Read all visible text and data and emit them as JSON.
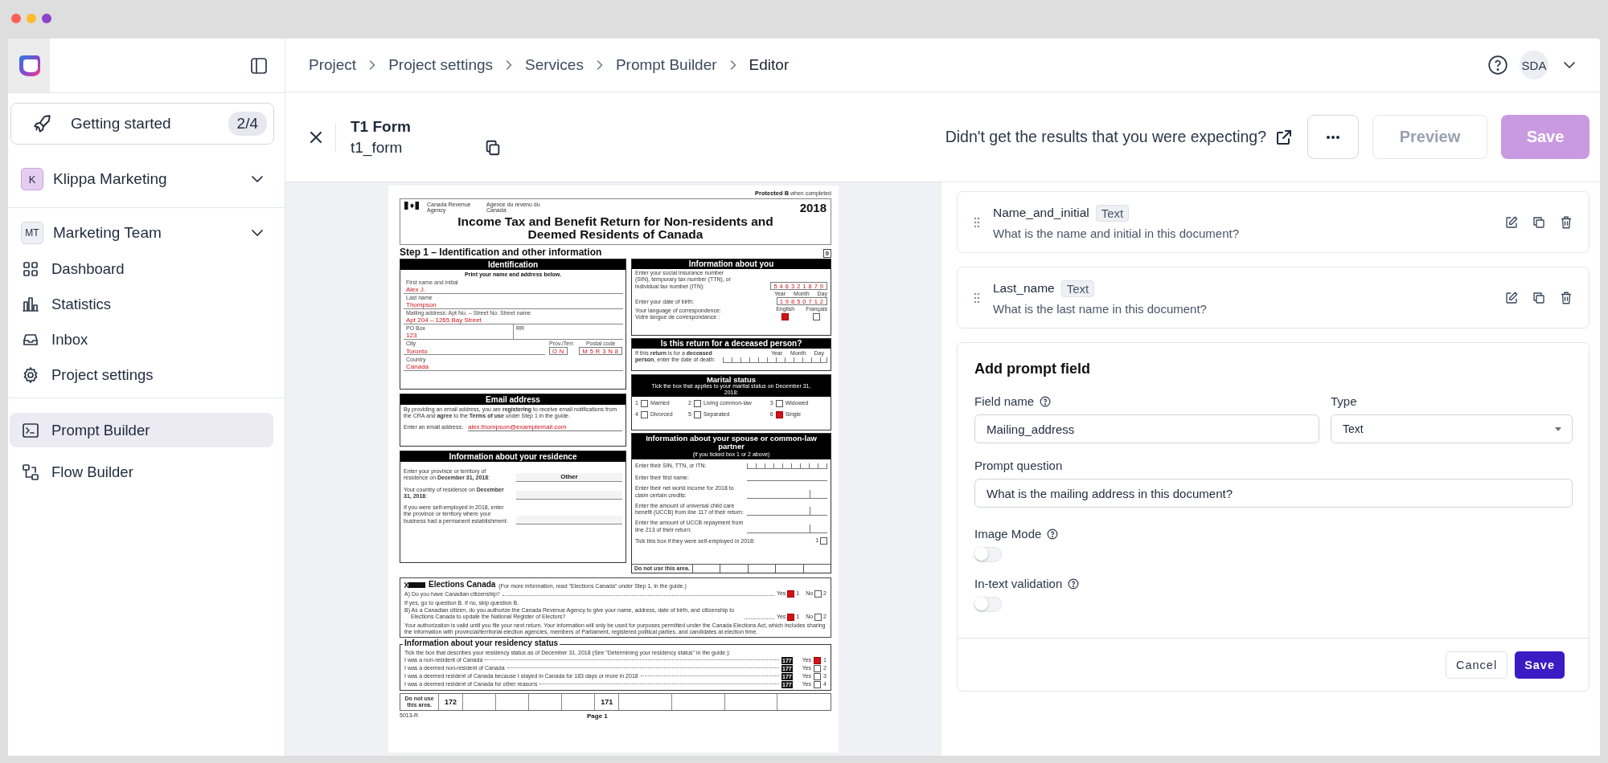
{
  "window": {
    "controls": [
      {
        "color": "#ff5f57"
      },
      {
        "color": "#febc2e"
      },
      {
        "color": "#8e44c9"
      }
    ]
  },
  "sidebar": {
    "getting_started": {
      "label": "Getting started",
      "count": "2/4"
    },
    "workspace": {
      "initial": "K",
      "name": "Klippa Marketing"
    },
    "team": {
      "initial": "MT",
      "name": "Marketing Team"
    },
    "nav": [
      {
        "label": "Dashboard",
        "kind": "grid",
        "selected": false
      },
      {
        "label": "Statistics",
        "kind": "chart",
        "selected": false
      },
      {
        "label": "Inbox",
        "kind": "inbox",
        "selected": false
      },
      {
        "label": "Project settings",
        "kind": "gear",
        "selected": false
      }
    ],
    "tools": [
      {
        "label": "Prompt Builder",
        "kind": "terminal",
        "selected": true
      },
      {
        "label": "Flow Builder",
        "kind": "flow",
        "selected": false
      }
    ]
  },
  "breadcrumb": [
    {
      "label": "Project",
      "current": false
    },
    {
      "label": "Project settings",
      "current": false
    },
    {
      "label": "Services",
      "current": false
    },
    {
      "label": "Prompt Builder",
      "current": false
    },
    {
      "label": "Editor",
      "current": true
    }
  ],
  "user": {
    "initials": "SDA"
  },
  "editor": {
    "title": "T1 Form",
    "slug": "t1_form",
    "feedback": "Didn't get the results that you were expecting?",
    "buttons": [
      {
        "label": "Preview",
        "kind": "outline",
        "disabled": true
      },
      {
        "label": "Save",
        "kind": "primary",
        "disabled": true
      }
    ]
  },
  "document": {
    "protected": "Protected B",
    "protected_note": "when completed",
    "agency_en": "Canada Revenue Agency",
    "agency_fr": "Agence du revenu du Canada",
    "year": "2018",
    "title": "Income Tax and Benefit Return for Non-residents and Deemed Residents of Canada",
    "step": "Step 1 – Identification and other information",
    "step_box": "9",
    "identification": {
      "heading": "Identification",
      "instruction": "Print your name and address below.",
      "first_name": {
        "label": "First name and initial",
        "value": "Alex J."
      },
      "last_name": {
        "label": "Last name",
        "value": "Thompson"
      },
      "address": {
        "label": "Mailing address: Apt No. – Street No. Street name",
        "value": "Apt 204 – 1265 Bay Street"
      },
      "po_box": {
        "label": "PO Box",
        "value": "123"
      },
      "rr": {
        "label": "RR"
      },
      "city": {
        "label": "City",
        "value": "Toronto"
      },
      "province": {
        "label": "Prov./Terr.",
        "value": "ON"
      },
      "postal": {
        "label": "Postal code",
        "value": "M5R3N8"
      },
      "country": {
        "label": "Country",
        "value": "Canada"
      }
    },
    "email": {
      "heading": "Email address",
      "text": "By providing an email address, you are **registering** to receive email notifications from the CRA and **agree** to the **Terms of use** under Step 1 in the guide.",
      "label": "Enter an email address:",
      "value": "alex.thompson@examplemail.com"
    },
    "residence": {
      "heading": "Information about your residence",
      "rows": [
        {
          "label": "Enter your province or territory of residence on **December 31, 2018**:",
          "value": "Other"
        },
        {
          "label": "Your country of residence on **December 31, 2018**:"
        },
        {
          "label": "If you were self-employed in 2018, enter the province or territory where your business had a permanent establishment:"
        }
      ]
    },
    "about_you": {
      "heading": "Information about you",
      "sin_label": "Enter your social insurance number (SIN), temporary tax number (TTN), or individual tax number (ITN):",
      "sin": "546321879",
      "date_parts": [
        "Year",
        "Month",
        "Day"
      ],
      "birth_label": "Enter your date of birth:",
      "birth": "19850712",
      "language_label": "Your language of correspondence:",
      "language_label_fr": "Votre langue de correspondance :",
      "languages": [
        {
          "label": "English",
          "checked": true
        },
        {
          "label": "Français",
          "checked": false
        }
      ]
    },
    "deceased": {
      "heading": "Is this return for a deceased person?",
      "text": "If this **return** is for a **deceased person**, enter the date of death:",
      "date_parts": [
        "Year",
        "Month",
        "Day"
      ]
    },
    "marital": {
      "heading": "Marital status",
      "subheading": "Tick the box that applies to your marital status on December 31, 2018:",
      "options": [
        {
          "number": "1",
          "label": "Married",
          "checked": false
        },
        {
          "number": "2",
          "label": "Living common-law",
          "checked": false
        },
        {
          "number": "3",
          "label": "Widowed",
          "checked": false
        },
        {
          "number": "4",
          "label": "Divorced",
          "checked": false
        },
        {
          "number": "5",
          "label": "Separated",
          "checked": false
        },
        {
          "number": "6",
          "label": "Single",
          "checked": true
        }
      ]
    },
    "spouse": {
      "heading": "Information about your spouse or common-law partner",
      "note": "(if you ticked box 1 or 2 above)",
      "rows": [
        {
          "label": "Enter their SIN, TTN, or ITN:",
          "kind": "digits"
        },
        {
          "label": "Enter their first name:",
          "kind": "line"
        },
        {
          "label": "Enter their net world income for 2018 to claim certain credits:",
          "kind": "amount"
        },
        {
          "label": "Enter the amount of universal child care benefit (UCCB) from line 117 of their return:",
          "kind": "amount"
        },
        {
          "label": "Enter the amount of UCCB repayment from line 213 of their return:",
          "kind": "amount"
        }
      ],
      "self_employed": {
        "label": "Tick this box if they were self-employed in 2018:",
        "number": "1",
        "checked": false
      },
      "footer": "Do not use this area."
    },
    "elections": {
      "heading": "Elections Canada",
      "note": "(For more information, read \"Elections Canada\" under Step 1, in the guide.)",
      "questions": [
        {
          "text": "A) Do you have Canadian citizenship?",
          "yes": "Yes",
          "yes_number": "1",
          "yes_checked": true,
          "no": "No",
          "no_number": "2",
          "no_checked": false
        },
        {
          "intro": "If yes, go to question B. If no, skip question B.",
          "text": "B) As a Canadian citizen, do you authorize the Canada Revenue Agency to give your name, address, date of birth, and citizenship to Elections Canada to update the National Register of Electors?",
          "yes": "Yes",
          "yes_number": "1",
          "yes_checked": true,
          "no": "No",
          "no_number": "2",
          "no_checked": false
        }
      ],
      "disclaimer": "Your authorization is valid until you file your next return. Your information will only be used for purposes permitted under the Canada Elections Act, which includes sharing the information with provincial/territorial election agencies, members of Parliament, registered political parties, and candidates at election time."
    },
    "residency": {
      "heading": "Information about your residency status",
      "intro": "Tick the box that describes your residency status as of December 31, 2018 (See \"Determining your residency status\" in the guide.):",
      "rows": [
        {
          "text": "I was a non-resident of Canada",
          "code": "177",
          "yes": "Yes",
          "number": "1",
          "checked": true
        },
        {
          "text": "I was a deemed non-resident of Canada",
          "code": "177",
          "yes": "Yes",
          "number": "2",
          "checked": false
        },
        {
          "text": "I was a deemed resident of Canada because I stayed in Canada for 183 days or more in 2018",
          "code": "177",
          "yes": "Yes",
          "number": "3",
          "checked": false
        },
        {
          "text": "I was a deemed resident of Canada for other reasons",
          "code": "177",
          "yes": "Yes",
          "number": "4",
          "checked": false
        }
      ]
    },
    "office": {
      "label": "Do not use this area.",
      "codes": [
        "172",
        "171"
      ]
    },
    "form_number": "5013-R",
    "page": "Page 1"
  },
  "prompt_fields": [
    {
      "name": "Name_and_initial",
      "type": "Text",
      "question": "What is the name and initial in this document?"
    },
    {
      "name": "Last_name",
      "type": "Text",
      "question": "What is the last name in this document?"
    }
  ],
  "add_field": {
    "title": "Add prompt field",
    "field_name": {
      "label": "Field name",
      "value": "Mailing_address"
    },
    "type": {
      "label": "Type",
      "value": "Text"
    },
    "prompt_question": {
      "label": "Prompt question",
      "value": "What is the mailing address in this document?"
    },
    "toggles": [
      {
        "label": "Image Mode",
        "on": false
      },
      {
        "label": "In-text validation",
        "on": false
      }
    ],
    "buttons": [
      {
        "label": "Cancel",
        "kind": "secondary"
      },
      {
        "label": "Save",
        "kind": "primary"
      }
    ]
  }
}
